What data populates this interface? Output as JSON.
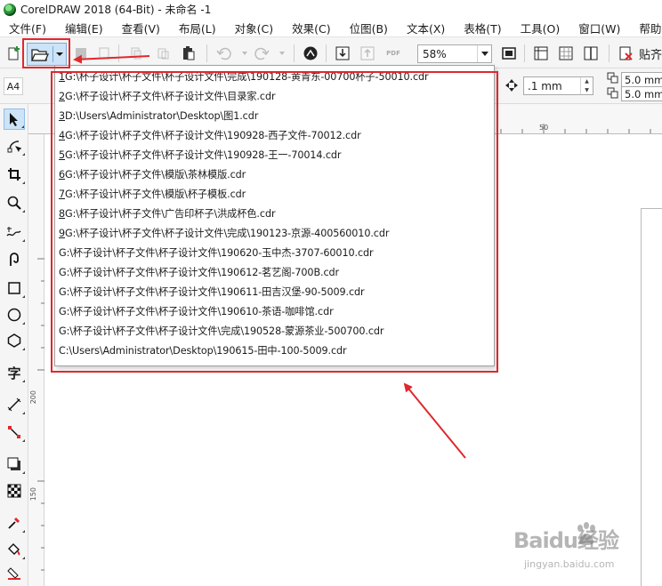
{
  "window": {
    "title": "CorelDRAW 2018 (64-Bit) - 未命名 -1",
    "app_icon": "coreldraw-balloon-icon"
  },
  "menubar": {
    "items": [
      {
        "label": "文件(F)"
      },
      {
        "label": "编辑(E)"
      },
      {
        "label": "查看(V)"
      },
      {
        "label": "布局(L)"
      },
      {
        "label": "对象(C)"
      },
      {
        "label": "效果(C)"
      },
      {
        "label": "位图(B)"
      },
      {
        "label": "文本(X)"
      },
      {
        "label": "表格(T)"
      },
      {
        "label": "工具(O)"
      },
      {
        "label": "窗口(W)"
      },
      {
        "label": "帮助(H)"
      }
    ]
  },
  "toolbar": {
    "zoom_value": "58%",
    "publish_pdf_label": "PDF",
    "publish_label": "贴齐"
  },
  "propbar": {
    "page_size": "A4",
    "nudge_value": ".1 mm",
    "dup_x": "5.0 mm",
    "dup_y": "5.0 mm"
  },
  "rulers": {
    "h_label": "50",
    "v_labels": [
      "200",
      "150"
    ]
  },
  "recent_files": {
    "items": [
      {
        "key": "1",
        "path": " G:\\杯子设计\\杯子文件\\杯子设计文件\\完成\\190128-黄青东-00700杯子-50010.cdr"
      },
      {
        "key": "2",
        "path": " G:\\杯子设计\\杯子文件\\杯子设计文件\\目录家.cdr"
      },
      {
        "key": "3",
        "path": " D:\\Users\\Administrator\\Desktop\\图1.cdr"
      },
      {
        "key": "4",
        "path": " G:\\杯子设计\\杯子文件\\杯子设计文件\\190928-西子文件-70012.cdr"
      },
      {
        "key": "5",
        "path": " G:\\杯子设计\\杯子文件\\杯子设计文件\\190928-王一-70014.cdr"
      },
      {
        "key": "6",
        "path": " G:\\杯子设计\\杯子文件\\模版\\茶林模版.cdr"
      },
      {
        "key": "7",
        "path": " G:\\杯子设计\\杯子文件\\模版\\杯子模板.cdr"
      },
      {
        "key": "8",
        "path": " G:\\杯子设计\\杯子文件\\广告印杯子\\洪成杯色.cdr"
      },
      {
        "key": "9",
        "path": " G:\\杯子设计\\杯子文件\\杯子设计文件\\完成\\190123-京源-400560010.cdr"
      },
      {
        "key": "",
        "path": "G:\\杯子设计\\杯子文件\\杯子设计文件\\190620-玉中杰-3707-60010.cdr"
      },
      {
        "key": "",
        "path": "G:\\杯子设计\\杯子文件\\杯子设计文件\\190612-茗艺阁-700B.cdr"
      },
      {
        "key": "",
        "path": "G:\\杯子设计\\杯子文件\\杯子设计文件\\190611-田吉汉堡-90-5009.cdr"
      },
      {
        "key": "",
        "path": "G:\\杯子设计\\杯子文件\\杯子设计文件\\190610-茶语-咖啡馆.cdr"
      },
      {
        "key": "",
        "path": "G:\\杯子设计\\杯子文件\\杯子设计文件\\完成\\190528-蒙源茶业-500700.cdr"
      },
      {
        "key": "",
        "path": "C:\\Users\\Administrator\\Desktop\\190615-田中-100-5009.cdr"
      }
    ]
  },
  "watermark": {
    "brand": "Baidu经验",
    "url": "jingyan.baidu.com"
  },
  "colors": {
    "annotation_red": "#e0282d",
    "selection_blue": "#cde3f7"
  }
}
